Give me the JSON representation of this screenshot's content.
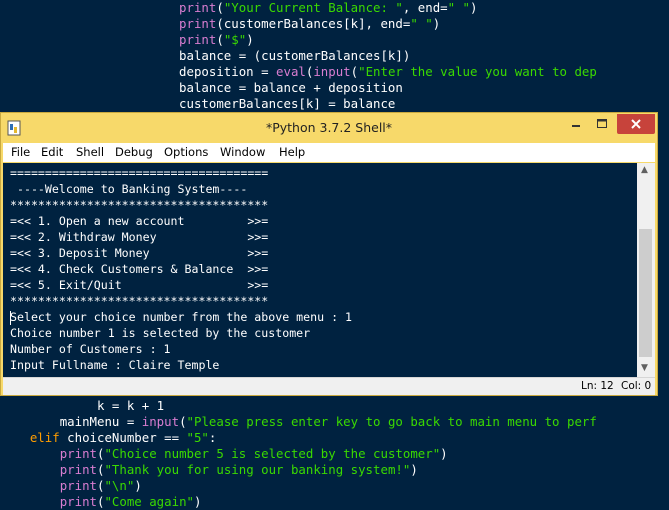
{
  "editor": {
    "top_lines": [
      {
        "indent": "                        ",
        "parts": [
          [
            "bi",
            "print"
          ],
          [
            "n",
            "("
          ],
          [
            "str",
            "\"Your Current Balance: \""
          ],
          [
            "n",
            ", end="
          ],
          [
            "str",
            "\" \""
          ],
          [
            "n",
            ")"
          ]
        ]
      },
      {
        "indent": "                        ",
        "parts": [
          [
            "bi",
            "print"
          ],
          [
            "n",
            "(customerBalances[k], end="
          ],
          [
            "str",
            "\" \""
          ],
          [
            "n",
            ")"
          ]
        ]
      },
      {
        "indent": "                        ",
        "parts": [
          [
            "bi",
            "print"
          ],
          [
            "n",
            "("
          ],
          [
            "str",
            "\"$\""
          ],
          [
            "n",
            ")"
          ]
        ]
      },
      {
        "indent": "                        ",
        "parts": [
          [
            "n",
            "balance = (customerBalances[k])"
          ]
        ]
      },
      {
        "indent": "                        ",
        "parts": [
          [
            "n",
            "deposition = "
          ],
          [
            "bi",
            "eval"
          ],
          [
            "n",
            "("
          ],
          [
            "bi",
            "input"
          ],
          [
            "n",
            "("
          ],
          [
            "str",
            "\"Enter the value you want to dep"
          ]
        ]
      },
      {
        "indent": "                        ",
        "parts": [
          [
            "n",
            "balance = balance + deposition"
          ]
        ]
      },
      {
        "indent": "                        ",
        "parts": [
          [
            "n",
            "customerBalances[k] = balance"
          ]
        ]
      }
    ],
    "bottom_lines": [
      {
        "indent": "             ",
        "parts": [
          [
            "n",
            "k = k + 1"
          ]
        ]
      },
      {
        "indent": "        ",
        "parts": [
          [
            "n",
            "mainMenu = "
          ],
          [
            "bi",
            "input"
          ],
          [
            "n",
            "("
          ],
          [
            "str",
            "\"Please press enter key to go back to main menu to perf"
          ]
        ]
      },
      {
        "indent": "    ",
        "parts": [
          [
            "kw",
            "elif"
          ],
          [
            "n",
            " choiceNumber == "
          ],
          [
            "str",
            "\"5\""
          ],
          [
            "n",
            ":"
          ]
        ]
      },
      {
        "indent": "        ",
        "parts": [
          [
            "bi",
            "print"
          ],
          [
            "n",
            "("
          ],
          [
            "str",
            "\"Choice number 5 is selected by the customer\""
          ],
          [
            "n",
            ")"
          ]
        ]
      },
      {
        "indent": "        ",
        "parts": [
          [
            "bi",
            "print"
          ],
          [
            "n",
            "("
          ],
          [
            "str",
            "\"Thank you for using our banking system!\""
          ],
          [
            "n",
            ")"
          ]
        ]
      },
      {
        "indent": "        ",
        "parts": [
          [
            "bi",
            "print"
          ],
          [
            "n",
            "("
          ],
          [
            "str",
            "\"\\n\""
          ],
          [
            "n",
            ")"
          ]
        ]
      },
      {
        "indent": "        ",
        "parts": [
          [
            "bi",
            "print"
          ],
          [
            "n",
            "("
          ],
          [
            "str",
            "\"Come again\""
          ],
          [
            "n",
            ")"
          ]
        ]
      }
    ]
  },
  "window": {
    "title": "*Python 3.7.2 Shell*",
    "menu": [
      "File",
      "Edit",
      "Shell",
      "Debug",
      "Options",
      "Window",
      "Help"
    ],
    "shell_lines": [
      "=====================================",
      " ----Welcome to Banking System----",
      "*************************************",
      "=<< 1. Open a new account         >>=",
      "=<< 2. Withdraw Money             >>=",
      "=<< 3. Deposit Money              >>=",
      "=<< 4. Check Customers & Balance  >>=",
      "=<< 5. Exit/Quit                  >>=",
      "*************************************",
      "Select your choice number from the above menu : 1",
      "Choice number 1 is selected by the customer",
      "Number of Customers : 1",
      "Input Fullname : Claire Temple"
    ],
    "status": {
      "line": "Ln: 12",
      "col": "Col: 0"
    },
    "icons": {
      "app": "python-shell-icon",
      "minimize": "minimize-icon",
      "maximize": "maximize-icon",
      "close": "close-icon"
    }
  },
  "colors": {
    "background": "#002240",
    "keyword": "#ff9d00",
    "builtin": "#d87dd0",
    "string": "#3ad900",
    "text": "#ffffff",
    "titlebar": "#f7d96a",
    "close_button": "#c7433b"
  }
}
